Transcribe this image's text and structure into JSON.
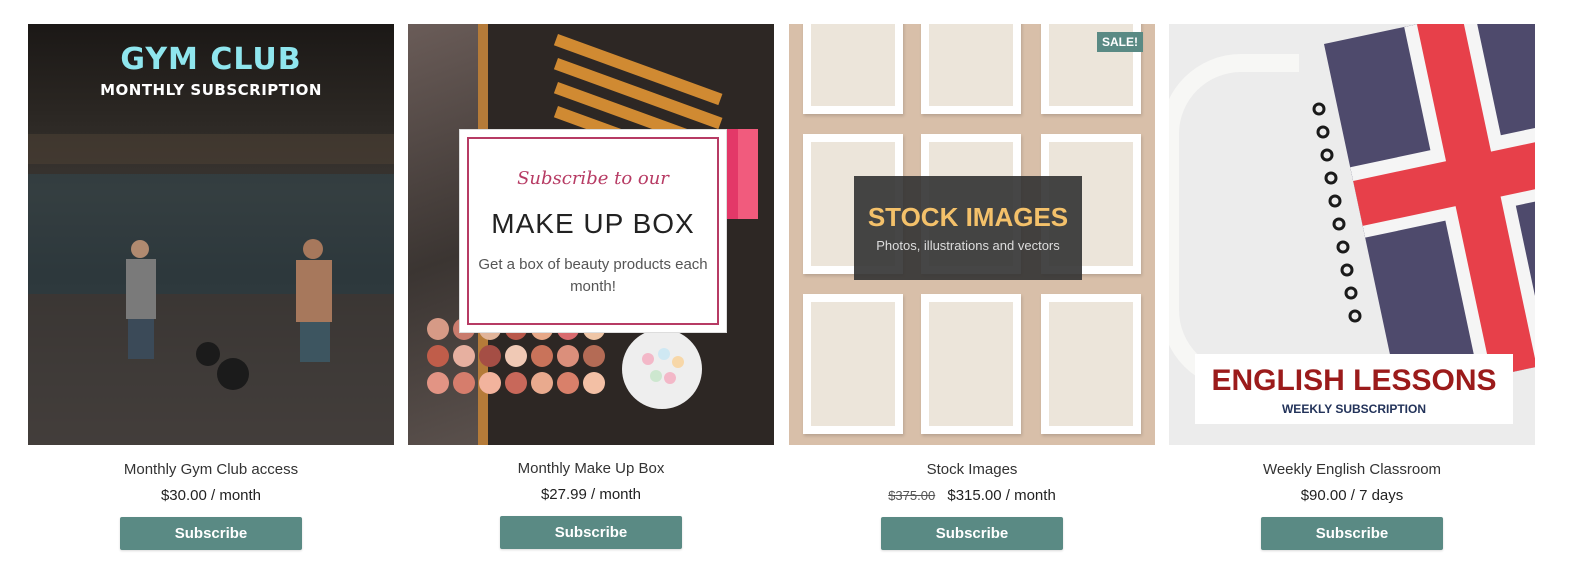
{
  "products": [
    {
      "name": "Monthly Gym Club access",
      "price": "$30.00 / month",
      "button_label": "Subscribe",
      "image": {
        "headline": "GYM CLUB",
        "subheadline": "MONTHLY SUBSCRIPTION"
      }
    },
    {
      "name": "Monthly Make Up Box",
      "price": "$27.99 / month",
      "button_label": "Subscribe",
      "image": {
        "script": "Subscribe to our",
        "headline": "MAKE UP BOX",
        "subheadline": "Get a box of beauty products each month!"
      }
    },
    {
      "name": "Stock Images",
      "original_price": "$375.00",
      "price": "$315.00 / month",
      "button_label": "Subscribe",
      "badge": "SALE!",
      "image": {
        "headline": "STOCK IMAGES",
        "subheadline": "Photos, illustrations and vectors"
      }
    },
    {
      "name": "Weekly English Classroom",
      "price": "$90.00 / 7 days",
      "button_label": "Subscribe",
      "image": {
        "headline": "ENGLISH LESSONS",
        "subheadline": "WEEKLY SUBSCRIPTION"
      }
    }
  ],
  "colors": {
    "button": "#5a8a84",
    "sale_badge": "#5a8a84"
  }
}
